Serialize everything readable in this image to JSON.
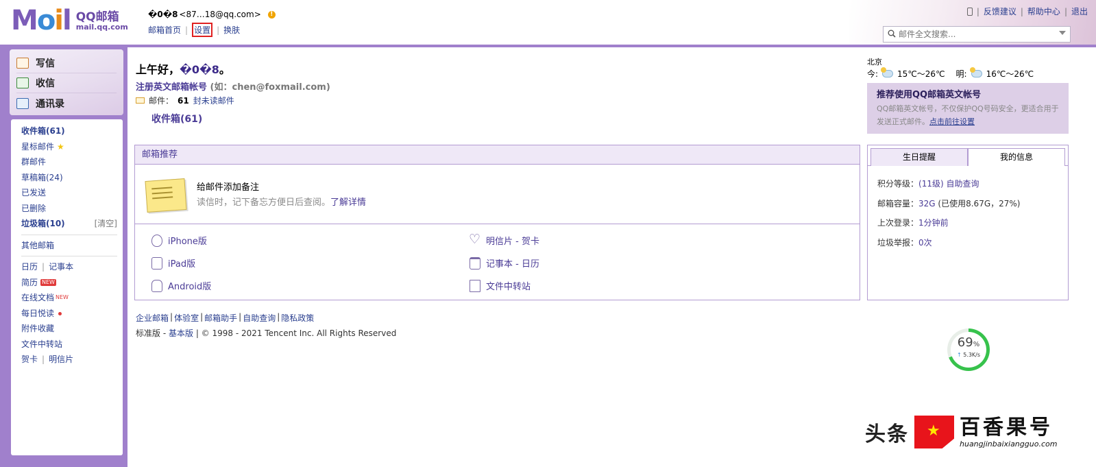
{
  "header": {
    "logo_main": "Mail",
    "logo_qq": "QQ邮箱",
    "logo_domain": "mail.qq.com",
    "user_name": "�0�8",
    "user_email": "<87…18@qq.com>",
    "nav": [
      "邮箱首页",
      "设置",
      "换肤"
    ],
    "top_links": [
      "反馈建议",
      "帮助中心",
      "退出"
    ],
    "search_placeholder": "邮件全文搜索..."
  },
  "sidebar": {
    "actions": [
      "写信",
      "收信",
      "通讯录"
    ],
    "folders": {
      "inbox": "收件箱(61)",
      "starred": "星标邮件",
      "group": "群邮件",
      "drafts": "草稿箱(24)",
      "sent": "已发送",
      "deleted": "已删除",
      "spam": "垃圾箱(10)",
      "spam_clear": "[清空]",
      "other": "其他邮箱",
      "calendar": "日历",
      "notebook": "记事本",
      "resume": "简历",
      "resume_badge": "NEW",
      "docs": "在线文档",
      "docs_badge": "NEW",
      "daily": "每日悦读",
      "attachments": "附件收藏",
      "transfer": "文件中转站",
      "card": "贺卡",
      "postcard": "明信片"
    }
  },
  "main": {
    "greeting_prefix": "上午好，",
    "greeting_name": "�0�8",
    "greeting_suffix": "。",
    "register_link": "注册英文邮箱帐号",
    "register_example": "(如：chen@foxmail.com)",
    "mail_label": "邮件：",
    "mail_count": "61",
    "mail_unread": "封未读邮件",
    "inbox_link": "收件箱(61)"
  },
  "recommend": {
    "title": "邮箱推荐",
    "feature_title": "给邮件添加备注",
    "feature_desc": "读信时，记下备忘方便日后查阅。",
    "feature_link": "了解详情",
    "apps": {
      "iphone": "iPhone版",
      "ipad": "iPad版",
      "android": "Android版",
      "postcard": "明信片 - 贺卡",
      "notebook": "记事本 - 日历",
      "transfer": "文件中转站"
    }
  },
  "weather": {
    "city": "北京",
    "today_label": "今:",
    "today_temp": "15℃～26℃",
    "tomorrow_label": "明:",
    "tomorrow_temp": "16℃～26℃"
  },
  "promo": {
    "title": "推荐使用QQ邮箱英文帐号",
    "desc": "QQ邮箱英文帐号，不仅保护QQ号码安全，更适合用于发送正式邮件。",
    "link": "点击前往设置"
  },
  "info": {
    "tabs": [
      "生日提醒",
      "我的信息"
    ],
    "rows": {
      "points_label": "积分等级：",
      "points_value": "(11级)",
      "points_link": "自助查询",
      "capacity_label": "邮箱容量：",
      "capacity_value": "32G",
      "capacity_used": "(已使用8.67G，27%)",
      "last_login_label": "上次登录：",
      "last_login_value": "1分钟前",
      "spam_label": "垃圾举报：",
      "spam_value": "0次"
    }
  },
  "footer": {
    "links": [
      "企业邮箱",
      "体验室",
      "邮箱助手",
      "自助查询",
      "隐私政策"
    ],
    "edition_label": "标准版",
    "basic_link": "基本版",
    "copyright": "| © 1998 - 2021 Tencent Inc. All Rights Reserved"
  },
  "gauge": {
    "percent": 69,
    "percent_unit": "%",
    "speed": "5.3K/s"
  },
  "watermark": {
    "left_text": "头条",
    "brand": "百香果号",
    "url": "huangjinbaixiangguo.com"
  }
}
